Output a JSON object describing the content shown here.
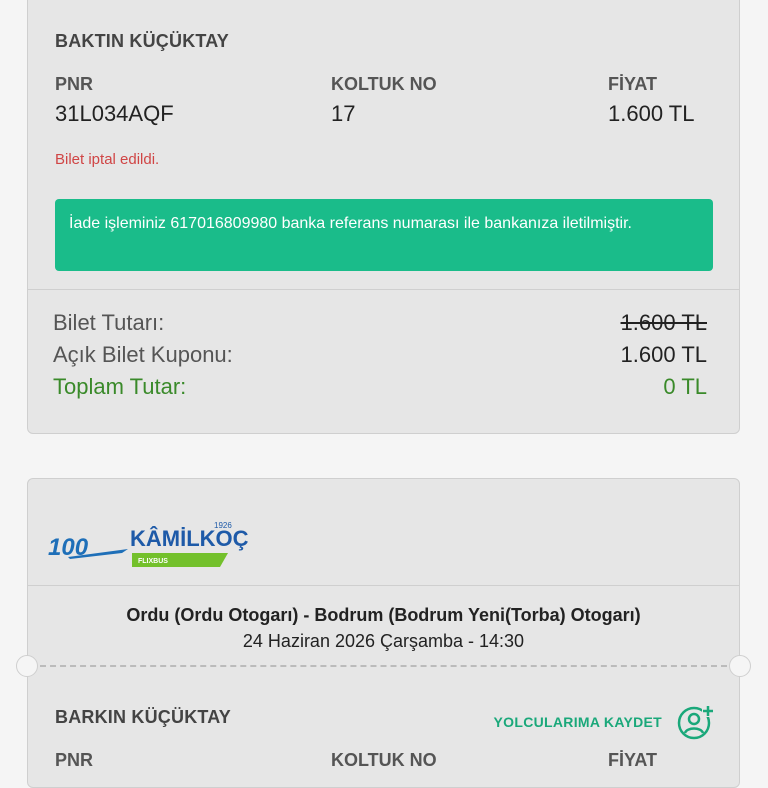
{
  "passenger1": {
    "name": "BAKTIN KÜÇÜKTAY",
    "pnr_label": "PNR",
    "pnr": "31L034AQF",
    "seat_label": "KOLTUK NO",
    "seat": "17",
    "price_label": "FİYAT",
    "price": "1.600 TL",
    "cancel_text": "Bilet iptal edildi.",
    "refund_text": "İade işleminiz 617016809980 banka referans numarası ile bankanıza iletilmiştir."
  },
  "summary": {
    "ticket_label": "Bilet Tutarı:",
    "ticket_value": "1.600 TL",
    "coupon_label": "Açık Bilet Kuponu:",
    "coupon_value": "1.600 TL",
    "total_label": "Toplam Tutar:",
    "total_value": "0 TL"
  },
  "trip": {
    "brand": "KÂMİLKOÇ",
    "brand_year": "1926",
    "brand_sub": "FLIXBUS",
    "brand_badge": "100",
    "route": "Ordu (Ordu Otogarı) - Bodrum (Bodrum Yeni(Torba) Otogarı)",
    "datetime": "24 Haziran 2026 Çarşamba - 14:30"
  },
  "passenger2": {
    "name": "BARKIN KÜÇÜKTAY",
    "save_label": "YOLCULARIMA KAYDET",
    "save_icon": "add-person-icon",
    "pnr_label": "PNR",
    "seat_label": "KOLTUK NO",
    "price_label": "FİYAT"
  },
  "colors": {
    "accent_green": "#1abc8a",
    "cancel_red": "#d04545",
    "total_green": "#3a8a2a"
  }
}
